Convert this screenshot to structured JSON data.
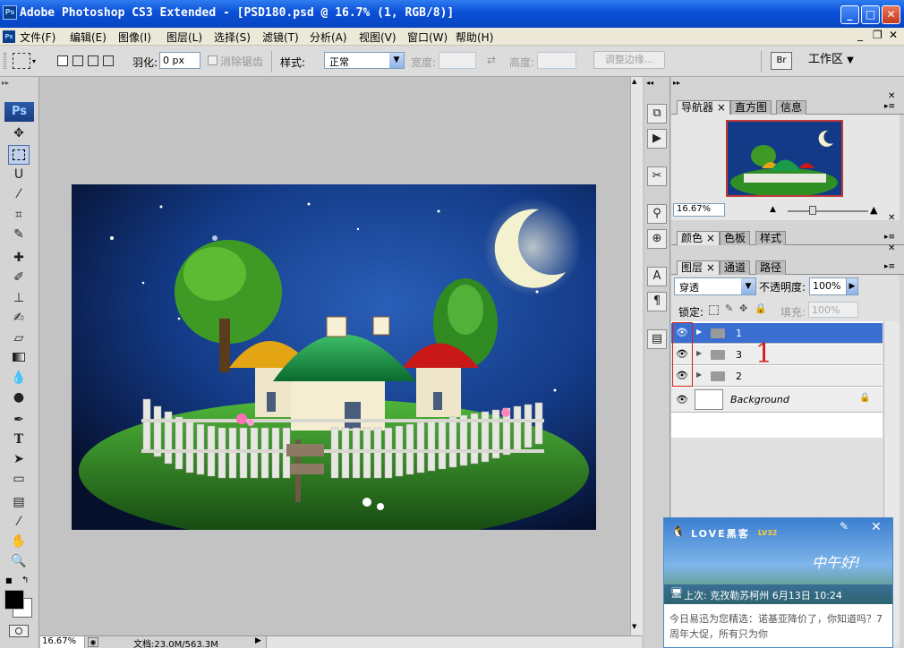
{
  "window": {
    "title": "Adobe Photoshop CS3 Extended - [PSD180.psd @ 16.7% (1, RGB/8)]",
    "min": "_",
    "max": "□",
    "close": "✕"
  },
  "menu": {
    "items": [
      "文件(F)",
      "编辑(E)",
      "图像(I)",
      "图层(L)",
      "选择(S)",
      "滤镜(T)",
      "分析(A)",
      "视图(V)",
      "窗口(W)",
      "帮助(H)"
    ],
    "doc_controls": [
      "_",
      "❐",
      "✕"
    ]
  },
  "options": {
    "feather_label": "羽化:",
    "feather_value": "0 px",
    "antialias_label": "消除锯齿",
    "style_label": "样式:",
    "style_value": "正常",
    "width_label": "宽度:",
    "height_label": "高度:",
    "refine_edge": "调整边缘...",
    "workspace": "工作区"
  },
  "toolbox": {
    "logo": "Ps"
  },
  "status": {
    "zoom": "16.67%",
    "doc_info": "文档:23.0M/563.3M"
  },
  "navigator": {
    "tabs": [
      "导航器",
      "直方图",
      "信息"
    ],
    "zoom": "16.67%"
  },
  "color_panel": {
    "tabs": [
      "颜色",
      "色板",
      "样式"
    ]
  },
  "layers_panel": {
    "tabs": [
      "图层",
      "通道",
      "路径"
    ],
    "blend_mode": "穿透",
    "opacity_label": "不透明度:",
    "opacity_value": "100%",
    "lock_label": "锁定:",
    "fill_label": "填充:",
    "fill_value": "100%",
    "annotation": "1",
    "layers": [
      {
        "name": "1",
        "type": "group",
        "selected": true
      },
      {
        "name": "3",
        "type": "group",
        "selected": false
      },
      {
        "name": "2",
        "type": "group",
        "selected": false
      },
      {
        "name": "Background",
        "type": "background",
        "selected": false
      }
    ]
  },
  "qq_popup": {
    "title": "LOVE黑客",
    "level": "LV32",
    "greeting": "中午好!",
    "login": "上次: 克孜勒苏柯州 6月13日 10:24",
    "news": "今日易迅为您精选：诺基亚降价了，你知道吗？7周年大促，所有只为你"
  },
  "colors": {
    "title_blue": "#0a4fd6",
    "layer_selected": "#3a6fd1",
    "annotation_red": "#d22020"
  }
}
